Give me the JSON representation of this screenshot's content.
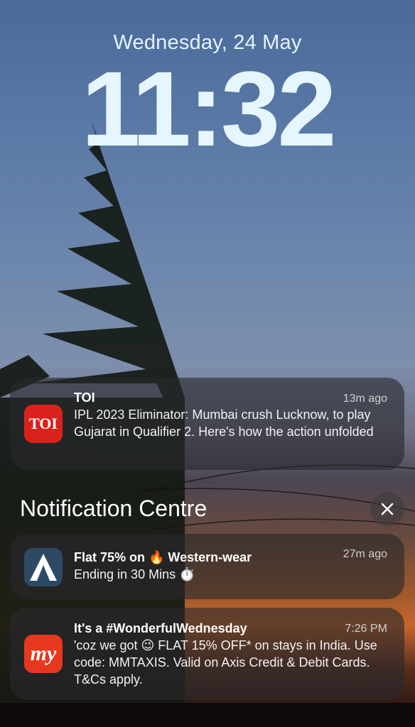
{
  "lockscreen": {
    "date": "Wednesday, 24 May",
    "time": "11:32"
  },
  "notifications": [
    {
      "app_icon": "toi-app-icon",
      "icon_text": "TOI",
      "title": "TOI",
      "time_ago": "13m ago",
      "body": "IPL 2023 Eliminator: Mumbai crush Lucknow, to play Gujarat in Qualifier 2. Here's how the action unfolded"
    }
  ],
  "notification_centre": {
    "title": "Notification Centre",
    "close_icon": "close-icon",
    "items": [
      {
        "app_icon": "ajio-app-icon",
        "title": "Flat 75% on 🔥 Western-wear",
        "time_ago": "27m ago",
        "body": "Ending in 30 Mins ⏱️"
      },
      {
        "app_icon": "makemytrip-app-icon",
        "icon_text": "my",
        "title": "It's a #WonderfulWednesday",
        "time_ago": "7:26 PM",
        "body": "'coz we got 😉 FLAT 15% OFF* on stays in India. Use code: MMTAXIS. Valid on Axis Credit & Debit Cards. T&Cs apply."
      }
    ]
  },
  "colors": {
    "toi_red": "#d9221c",
    "ajio_navy": "#2d4a64",
    "mmt_red": "#e5381f",
    "card_bg": "rgba(40,40,44,0.62)"
  }
}
